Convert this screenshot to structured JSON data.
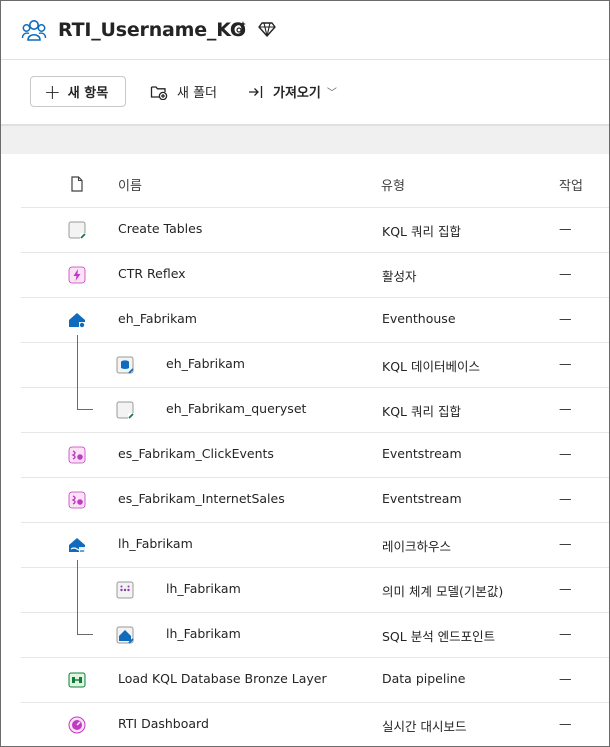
{
  "workspace": {
    "title": "RTI_Username_KO",
    "icons": [
      "workspace-people-icon",
      "settings-sparkle-icon",
      "diamond-icon"
    ]
  },
  "toolbar": {
    "new_item": "새 항목",
    "new_folder": "새 폴더",
    "import": "가져오기"
  },
  "columns": {
    "name": "이름",
    "type": "유형",
    "task": "작업"
  },
  "rows": [
    {
      "name": "Create Tables",
      "type": "KQL 쿼리 집합",
      "task": "—",
      "icon": "kql-queryset-icon",
      "child": false
    },
    {
      "name": "CTR Reflex",
      "type": "활성자",
      "task": "—",
      "icon": "activator-icon",
      "child": false
    },
    {
      "name": "eh_Fabrikam",
      "type": "Eventhouse",
      "task": "—",
      "icon": "eventhouse-icon",
      "child": false
    },
    {
      "name": "eh_Fabrikam",
      "type": "KQL 데이터베이스",
      "task": "—",
      "icon": "kql-database-icon",
      "child": true
    },
    {
      "name": "eh_Fabrikam_queryset",
      "type": "KQL 쿼리 집합",
      "task": "—",
      "icon": "kql-queryset-icon",
      "child": true
    },
    {
      "name": "es_Fabrikam_ClickEvents",
      "type": "Eventstream",
      "task": "—",
      "icon": "eventstream-icon",
      "child": false
    },
    {
      "name": "es_Fabrikam_InternetSales",
      "type": "Eventstream",
      "task": "—",
      "icon": "eventstream-icon",
      "child": false
    },
    {
      "name": "lh_Fabrikam",
      "type": "레이크하우스",
      "task": "—",
      "icon": "lakehouse-icon",
      "child": false
    },
    {
      "name": "lh_Fabrikam",
      "type": "의미 체계 모델(기본값)",
      "task": "—",
      "icon": "semantic-model-icon",
      "child": true
    },
    {
      "name": "lh_Fabrikam",
      "type": "SQL 분석 엔드포인트",
      "task": "—",
      "icon": "sql-endpoint-icon",
      "child": true
    },
    {
      "name": "Load KQL Database Bronze Layer",
      "type": "Data pipeline",
      "task": "—",
      "icon": "pipeline-icon",
      "child": false
    },
    {
      "name": "RTI Dashboard",
      "type": "실시간 대시보드",
      "task": "—",
      "icon": "dashboard-icon",
      "child": false
    }
  ],
  "colors": {
    "accent_green": "#107c41",
    "activator_pink": "#c03bc4",
    "eventhouse_blue": "#0f6cbd",
    "border": "#e6e6e6"
  }
}
